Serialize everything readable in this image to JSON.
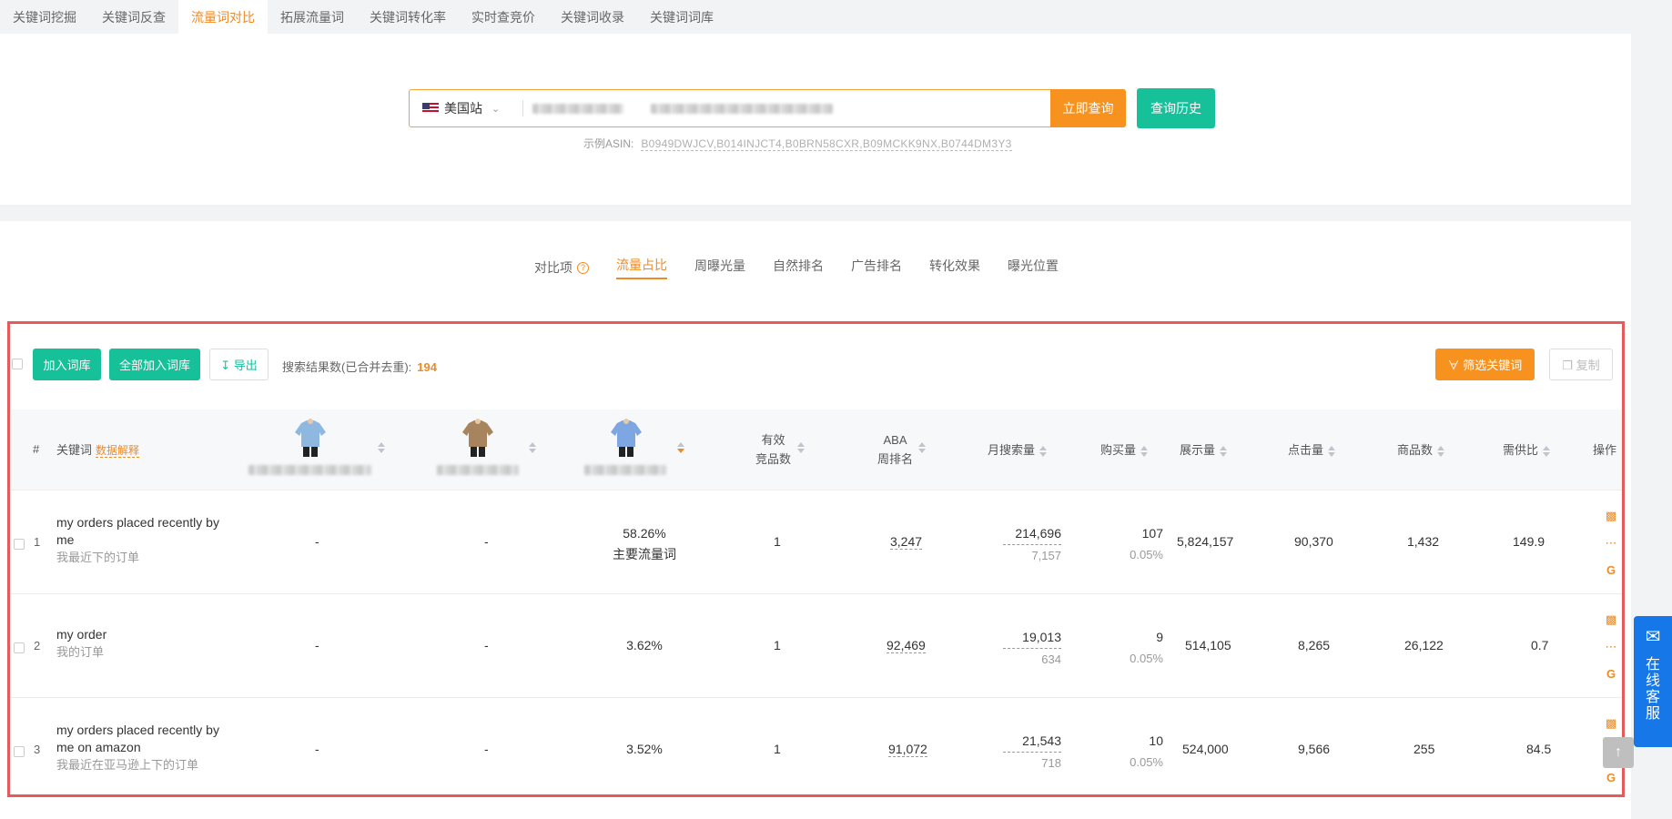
{
  "topnav": {
    "tabs": [
      {
        "label": "关键词挖掘"
      },
      {
        "label": "关键词反查"
      },
      {
        "label": "流量词对比",
        "active": true
      },
      {
        "label": "拓展流量词"
      },
      {
        "label": "关键词转化率"
      },
      {
        "label": "实时查竞价"
      },
      {
        "label": "关键词收录"
      },
      {
        "label": "关键词词库"
      }
    ]
  },
  "search": {
    "site": "美国站",
    "query_button": "立即查询",
    "history_button": "查询历史",
    "example_label": "示例ASIN:",
    "example_asins": "B0949DWJCV,B014INJCT4,B0BRN58CXR,B09MCKK9NX,B0744DM3Y3"
  },
  "compare_tabs": {
    "label": "对比项",
    "tabs": [
      "流量占比",
      "周曝光量",
      "自然排名",
      "广告排名",
      "转化效果",
      "曝光位置"
    ],
    "active_index": 0
  },
  "toolbar": {
    "add_label": "加入词库",
    "add_all_label": "全部加入词库",
    "export_label": "导出",
    "result_label": "搜索结果数(已合并去重):",
    "result_count": "194",
    "filter_label": "筛选关键词",
    "copy_label": "复制"
  },
  "table": {
    "headers": {
      "index": "#",
      "keyword": "关键词",
      "data_explain": "数据解释",
      "competitors_1": "有效",
      "competitors_2": "竞品数",
      "aba_1": "ABA",
      "aba_2": "周排名",
      "monthly": "月搜索量",
      "purchase": "购买量",
      "impressions": "展示量",
      "clicks": "点击量",
      "products": "商品数",
      "ratio": "需供比",
      "ops": "操作"
    },
    "product_colors": [
      "#8fb8e0",
      "#a8845e",
      "#7ea6e0"
    ],
    "rows": [
      {
        "index": "1",
        "keyword": "my orders placed recently by me",
        "keyword_cn": "我最近下的订单",
        "p1": "-",
        "p2": "-",
        "p3": "58.26%",
        "p3_tag": "主要流量词",
        "competitors": "1",
        "aba": "3,247",
        "monthly": "214,696",
        "monthly_sub": "7,157",
        "purchase": "107",
        "purchase_rate": "0.05%",
        "impressions": "5,824,157",
        "clicks": "90,370",
        "products": "1,432",
        "ratio": "149.9"
      },
      {
        "index": "2",
        "keyword": "my order",
        "keyword_cn": "我的订单",
        "p1": "-",
        "p2": "-",
        "p3": "3.62%",
        "p3_tag": "",
        "competitors": "1",
        "aba": "92,469",
        "monthly": "19,013",
        "monthly_sub": "634",
        "purchase": "9",
        "purchase_rate": "0.05%",
        "impressions": "514,105",
        "clicks": "8,265",
        "products": "26,122",
        "ratio": "0.7"
      },
      {
        "index": "3",
        "keyword": "my orders placed recently by me on amazon",
        "keyword_cn": "我最近在亚马逊上下的订单",
        "p1": "-",
        "p2": "-",
        "p3": "3.52%",
        "p3_tag": "",
        "competitors": "1",
        "aba": "91,072",
        "monthly": "21,543",
        "monthly_sub": "718",
        "purchase": "10",
        "purchase_rate": "0.05%",
        "impressions": "524,000",
        "clicks": "9,566",
        "products": "255",
        "ratio": "84.5"
      }
    ]
  },
  "support": {
    "label": "在线客服"
  }
}
